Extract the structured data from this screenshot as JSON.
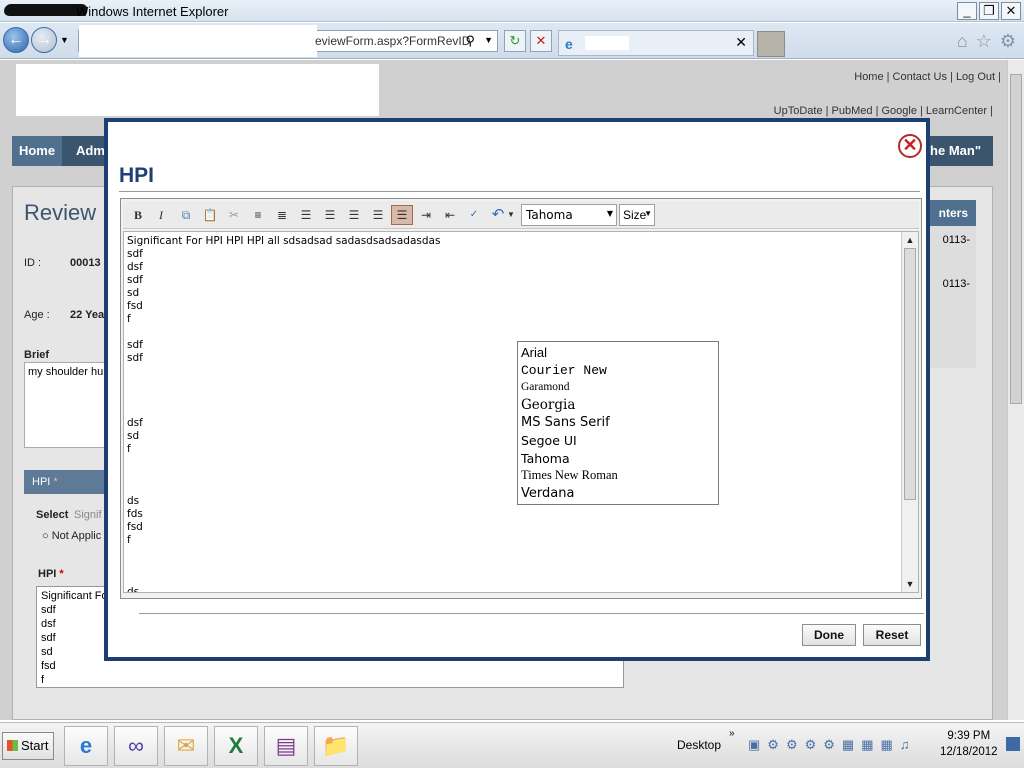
{
  "window": {
    "title": "Windows Internet Explorer",
    "controls": [
      "_",
      "❐",
      "✕"
    ]
  },
  "browser": {
    "address_text": "eviewForm.aspx?FormRevID",
    "nav_icons": [
      "home-icon",
      "favorites-icon",
      "tools-icon"
    ]
  },
  "background_page": {
    "top_links": "Home | Contact Us | Log Out |",
    "resource_links": "UpToDate | PubMed | Google | LearnCenter |",
    "nav": {
      "home": "Home",
      "admin": "Adm",
      "right_text": "The Man\""
    },
    "review_title": "Review",
    "id_label": "ID :",
    "id_value": "00013",
    "age_label": "Age :",
    "age_value": "22 Yea",
    "brief_label": "Brief",
    "brief_text": "my shoulder hu",
    "hpi_header": "HPI",
    "select_label": "Select",
    "select_value": "Signif",
    "not_applicable": "Not Applic",
    "hpi_label": "HPI",
    "hpi_lines": [
      "Significant Fo",
      "sdf",
      "dsf",
      "sdf",
      "sd",
      "fsd",
      "f"
    ],
    "right_header": "nters",
    "right_values": [
      "0113-",
      "0113-"
    ]
  },
  "modal": {
    "title": "HPI",
    "close_icon": "close-icon",
    "toolbar": {
      "font_selected": "Tahoma",
      "size_label": "Size"
    },
    "content_lines": [
      "Significant For HPI HPI HPI all sdsadsad sadasdsadsadasdas",
      "sdf",
      "dsf",
      "sdf",
      "sd",
      "fsd",
      "f",
      "",
      "sdf",
      "sdf",
      "",
      "",
      "",
      "",
      "dsf",
      "sd",
      "f",
      "",
      "",
      "",
      "ds",
      "fds",
      "fsd",
      "f",
      "",
      "",
      "",
      "ds"
    ],
    "font_options": [
      "Arial",
      "Courier New",
      "Garamond",
      "Georgia",
      "MS Sans Serif",
      "Segoe UI",
      "Tahoma",
      "Times New Roman",
      "Verdana"
    ],
    "done_label": "Done",
    "reset_label": "Reset"
  },
  "taskbar": {
    "start_label": "Start",
    "desktop_label": "Desktop",
    "time": "9:39 PM",
    "date": "12/18/2012"
  },
  "colors": {
    "modal_border": "#1e3f73",
    "heading": "#1e3f73",
    "nav_bar": "#3c556f"
  }
}
